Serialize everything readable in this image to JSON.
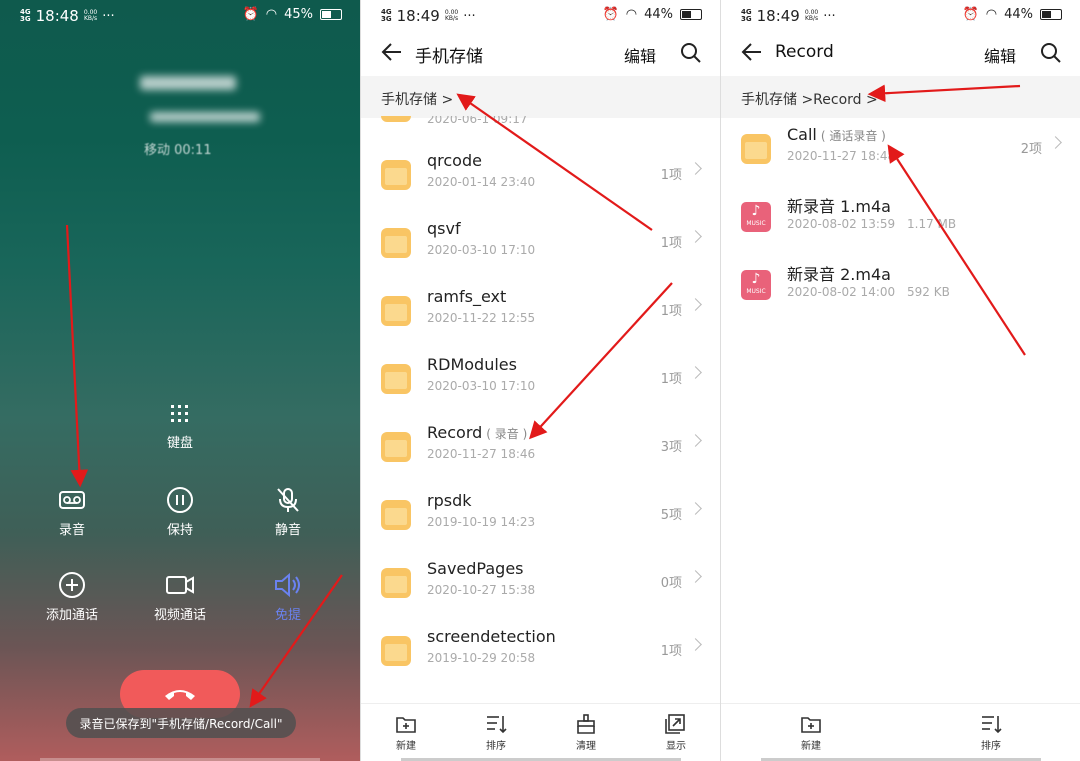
{
  "screens": [
    {
      "status": {
        "net": "4G",
        "net2": "3G",
        "time": "18:48",
        "speed": "0.00",
        "speed_unit": "KB/s",
        "battery": "45%",
        "battery_level": 0.45
      },
      "call": {
        "status": "移动 00:11"
      },
      "buttons": {
        "keypad": "键盘",
        "record": "录音",
        "hold": "保持",
        "mute": "静音",
        "add_call": "添加通话",
        "video_call": "视频通话",
        "speaker": "免提"
      },
      "toast": "录音已保存到\"手机存储/Record/Call\""
    },
    {
      "status": {
        "net": "4G",
        "net2": "3G",
        "time": "18:49",
        "speed": "0.00",
        "speed_unit": "KB/s",
        "battery": "44%",
        "battery_level": 0.44
      },
      "header": {
        "title": "手机存储",
        "edit": "编辑"
      },
      "breadcrumb": "手机存储 >",
      "partial_date": "2020-06-1 09:17",
      "rows": [
        {
          "name": "qrcode",
          "tag": "",
          "date": "2020-01-14 23:40",
          "count": "1项"
        },
        {
          "name": "qsvf",
          "tag": "",
          "date": "2020-03-10 17:10",
          "count": "1项"
        },
        {
          "name": "ramfs_ext",
          "tag": "",
          "date": "2020-11-22 12:55",
          "count": "1项"
        },
        {
          "name": "RDModules",
          "tag": "",
          "date": "2020-03-10 17:10",
          "count": "1项"
        },
        {
          "name": "Record",
          "tag": "( 录音 )",
          "date": "2020-11-27 18:46",
          "count": "3项"
        },
        {
          "name": "rpsdk",
          "tag": "",
          "date": "2019-10-19 14:23",
          "count": "5项"
        },
        {
          "name": "SavedPages",
          "tag": "",
          "date": "2020-10-27 15:38",
          "count": "0项"
        },
        {
          "name": "screendetection",
          "tag": "",
          "date": "2019-10-29 20:58",
          "count": "1项"
        }
      ],
      "bottom": {
        "new": "新建",
        "sort": "排序",
        "clean": "清理",
        "show": "显示"
      }
    },
    {
      "status": {
        "net": "4G",
        "net2": "3G",
        "time": "18:49",
        "speed": "0.00",
        "speed_unit": "KB/s",
        "battery": "44%",
        "battery_level": 0.44
      },
      "header": {
        "title": "Record",
        "edit": "编辑"
      },
      "breadcrumb": "手机存储 >Record >",
      "rows": [
        {
          "name": "Call",
          "tag": "( 通话录音 )",
          "date": "2020-11-27 18:48",
          "count": "2项",
          "icon": "folder"
        },
        {
          "name": "新录音 1.m4a",
          "tag": "",
          "date": "2020-08-02 13:59",
          "size": "1.17 MB",
          "icon": "music"
        },
        {
          "name": "新录音 2.m4a",
          "tag": "",
          "date": "2020-08-02 14:00",
          "size": "592 KB",
          "icon": "music"
        }
      ],
      "music_label": "MUSIC",
      "bottom": {
        "new": "新建",
        "sort": "排序"
      }
    }
  ],
  "colors": {
    "accent": "#e21a1a",
    "folder": "#f9c564",
    "end_call": "#f15a5a",
    "speaker_active": "#6a82f0"
  }
}
